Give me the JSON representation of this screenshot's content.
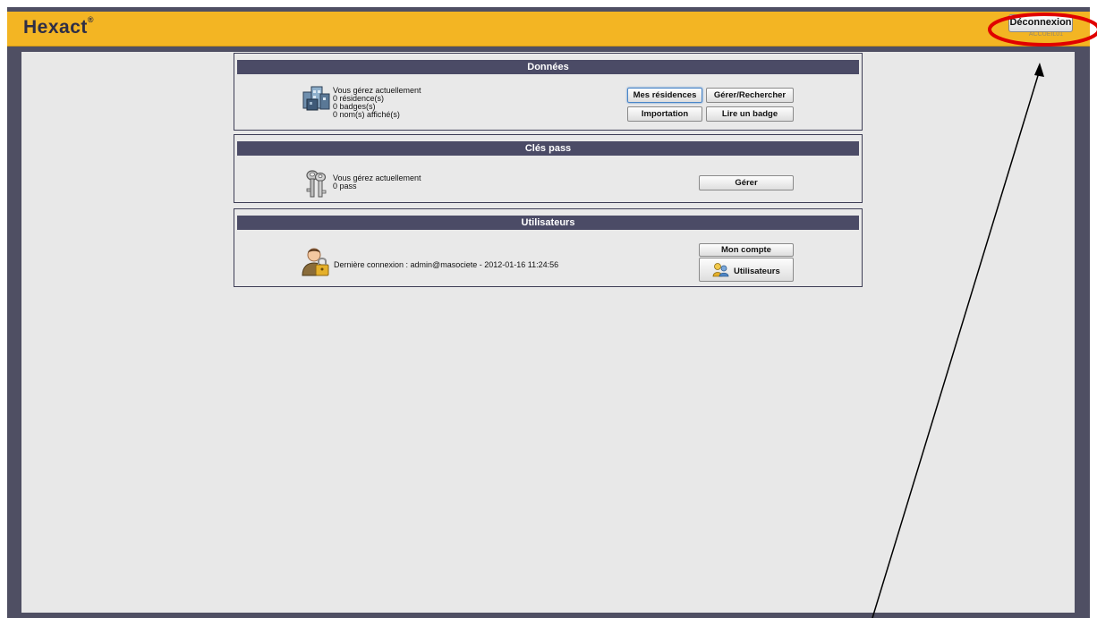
{
  "header": {
    "logo_text": "Hexact",
    "logo_mark": "®",
    "logout_label": "Déconnexion",
    "session_label": "ACCUEIL01",
    "brand_color": "#f3b523"
  },
  "donnees": {
    "title": "Données",
    "icon": "buildings-icon",
    "summary": {
      "line1": "Vous gérez actuellement",
      "line2": "0 résidence(s)",
      "line3": "0 badges(s)",
      "line4": "0 nom(s) affiché(s)"
    },
    "buttons": {
      "mes_residences": "Mes résidences",
      "gerer_rechercher": "Gérer/Rechercher",
      "importation": "Importation",
      "lire_badge": "Lire un badge"
    }
  },
  "cles": {
    "title": "Clés pass",
    "icon": "keys-icon",
    "summary": {
      "line1": "Vous gérez actuellement",
      "line2": "0 pass"
    },
    "buttons": {
      "gerer": "Gérer"
    }
  },
  "utilisateurs": {
    "title": "Utilisateurs",
    "icon": "user-lock-icon",
    "last_login": "Dernière connexion : admin@masociete - 2012-01-16 11:24:56",
    "buttons": {
      "mon_compte": "Mon compte",
      "utilisateurs": "Utilisateurs"
    }
  },
  "annotation": {
    "highlight_color": "#e00000",
    "arrow_color": "#000000"
  }
}
